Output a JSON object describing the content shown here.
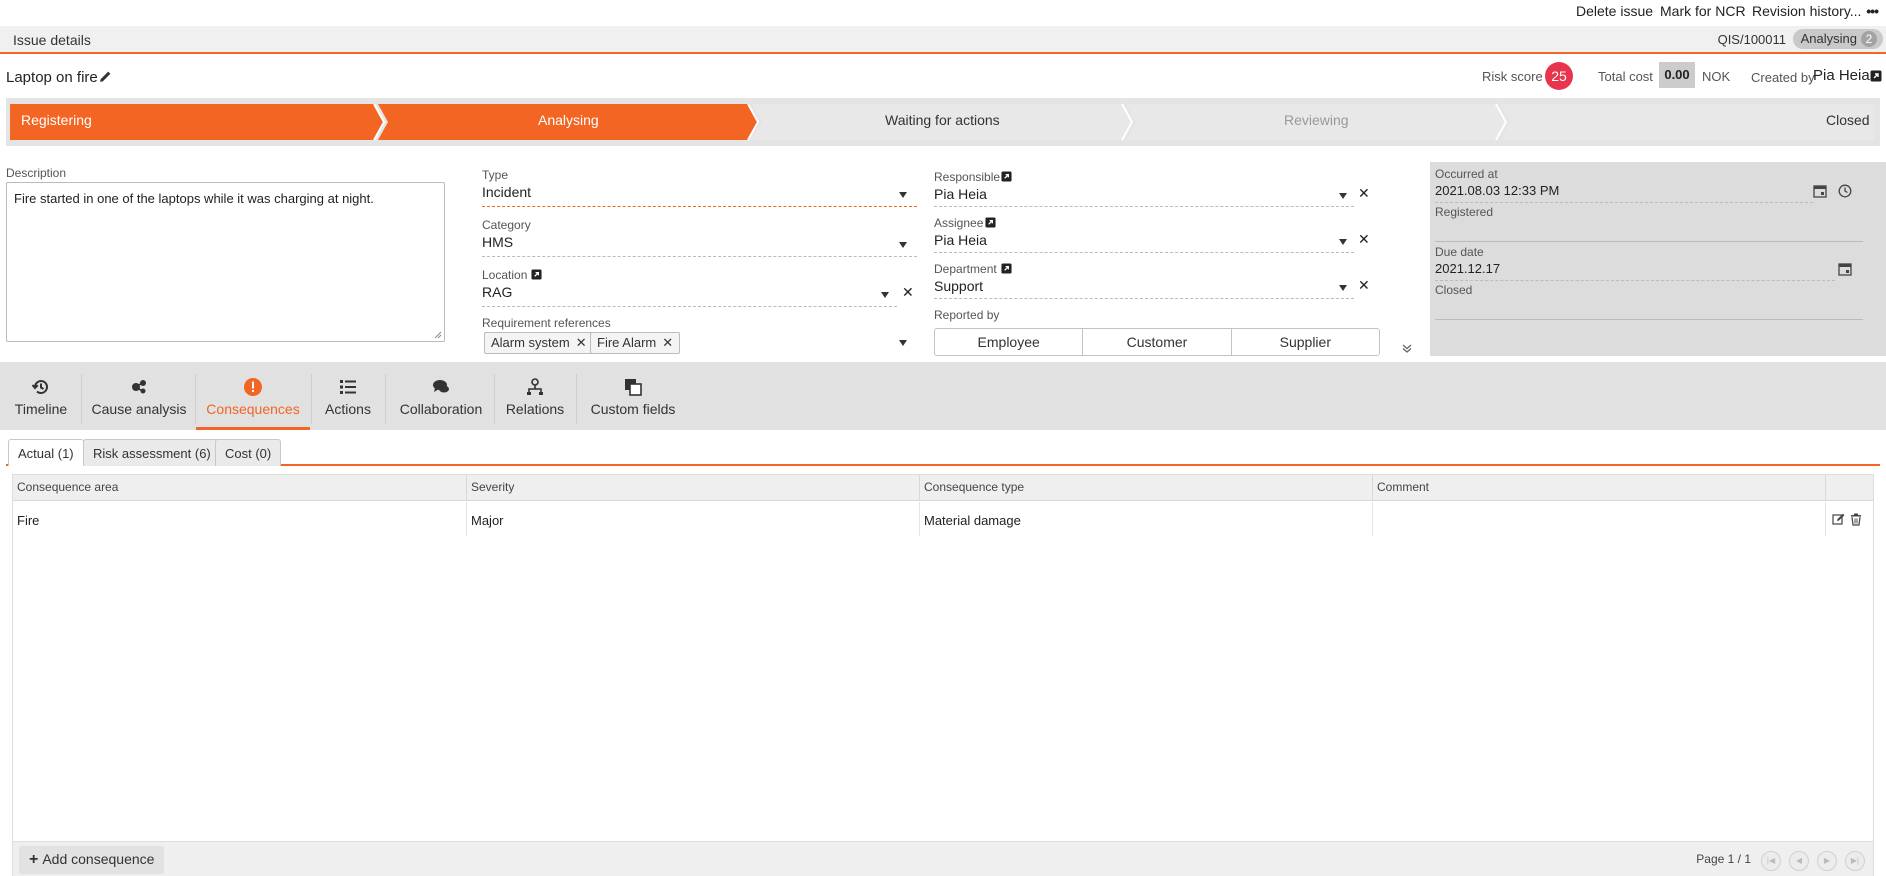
{
  "top_actions": {
    "delete_issue": "Delete issue",
    "mark_ncr": "Mark for NCR",
    "revision_history": "Revision history...",
    "more": "•••"
  },
  "details_bar": {
    "title": "Issue details",
    "issue_id": "QIS/100011",
    "status": "Analysing",
    "status_count": "2"
  },
  "issue": {
    "title": "Laptop on fire",
    "risk_score_label": "Risk score",
    "risk_score": "25",
    "total_cost_label": "Total cost",
    "total_cost": "0.00",
    "currency": "NOK",
    "created_by_label": "Created by",
    "created_by": "Pia Heia"
  },
  "progress": {
    "steps": [
      "Registering",
      "Analysing",
      "Waiting for actions",
      "Reviewing",
      "Closed"
    ]
  },
  "form": {
    "description_label": "Description",
    "description": "Fire started in one of the laptops while it was charging at night.",
    "type_label": "Type",
    "type": "Incident",
    "category_label": "Category",
    "category": "HMS",
    "location_label": "Location",
    "location": "RAG",
    "requirement_label": "Requirement references",
    "requirements": [
      "Alarm system",
      "Fire Alarm"
    ],
    "responsible_label": "Responsible",
    "responsible": "Pia  Heia",
    "assignee_label": "Assignee",
    "assignee": "Pia  Heia",
    "department_label": "Department",
    "department": "Support",
    "reported_by_label": "Reported by",
    "reported_by_options": [
      "Employee",
      "Customer",
      "Supplier"
    ]
  },
  "dates": {
    "occurred_label": "Occurred at",
    "occurred": "2021.08.03 12:33 PM",
    "registered_label": "Registered",
    "due_label": "Due date",
    "due": "2021.12.17",
    "closed_label": "Closed"
  },
  "tabs": [
    {
      "label": "Timeline",
      "icon": "history-icon"
    },
    {
      "label": "Cause analysis",
      "icon": "cause-analysis-icon"
    },
    {
      "label": "Consequences",
      "icon": "exclamation-icon"
    },
    {
      "label": "Actions",
      "icon": "list-icon"
    },
    {
      "label": "Collaboration",
      "icon": "comments-icon"
    },
    {
      "label": "Relations",
      "icon": "hierarchy-icon"
    },
    {
      "label": "Custom fields",
      "icon": "copy-icon"
    }
  ],
  "subtabs": [
    "Actual (1)",
    "Risk assessment (6)",
    "Cost (0)"
  ],
  "grid": {
    "columns": [
      "Consequence area",
      "Severity",
      "Consequence type",
      "Comment"
    ],
    "rows": [
      {
        "area": "Fire",
        "severity": "Major",
        "type": "Material damage",
        "comment": ""
      }
    ],
    "add_label": "Add consequence",
    "page_info": "Page 1 / 1"
  },
  "colors": {
    "accent": "#f26522",
    "risk": "#e8344e"
  }
}
